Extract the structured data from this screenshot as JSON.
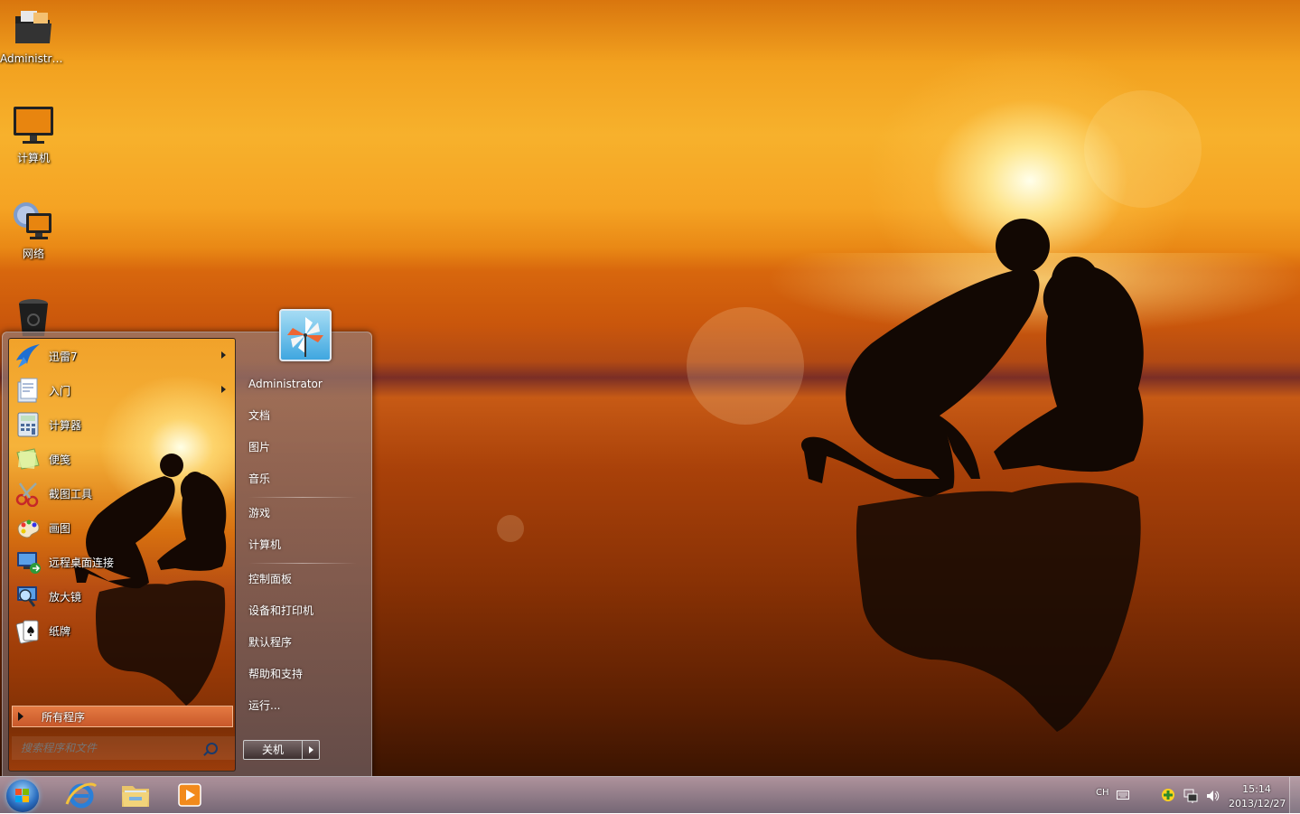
{
  "desktop": {
    "icons": [
      {
        "label": "Administra...",
        "icon": "folder-icon"
      },
      {
        "label": "计算机",
        "icon": "computer-icon"
      },
      {
        "label": "网络",
        "icon": "network-icon"
      },
      {
        "label": "",
        "icon": "recycle-bin-icon"
      }
    ]
  },
  "start_menu": {
    "programs": [
      {
        "label": "迅雷7",
        "icon": "xunlei-icon",
        "has_submenu": true
      },
      {
        "label": "入门",
        "icon": "getting-started-icon",
        "has_submenu": true
      },
      {
        "label": "计算器",
        "icon": "calculator-icon",
        "has_submenu": false
      },
      {
        "label": "便笺",
        "icon": "sticky-notes-icon",
        "has_submenu": false
      },
      {
        "label": "截图工具",
        "icon": "snipping-tool-icon",
        "has_submenu": false
      },
      {
        "label": "画图",
        "icon": "paint-icon",
        "has_submenu": false
      },
      {
        "label": "远程桌面连接",
        "icon": "remote-desktop-icon",
        "has_submenu": false
      },
      {
        "label": "放大镜",
        "icon": "magnifier-icon",
        "has_submenu": false
      },
      {
        "label": "纸牌",
        "icon": "solitaire-icon",
        "has_submenu": false
      }
    ],
    "all_programs_label": "所有程序",
    "search_placeholder": "搜索程序和文件",
    "right_links": {
      "user": "Administrator",
      "documents": "文档",
      "pictures": "图片",
      "music": "音乐",
      "games": "游戏",
      "computer": "计算机",
      "control_panel": "控制面板",
      "devices_printers": "设备和打印机",
      "default_programs": "默认程序",
      "help_support": "帮助和支持",
      "run": "运行..."
    },
    "shutdown_label": "关机"
  },
  "taskbar": {
    "pinned": [
      "internet-explorer-icon",
      "explorer-icon",
      "media-player-icon"
    ],
    "tray": {
      "language": "CH",
      "time": "15:14",
      "date": "2013/12/27"
    }
  }
}
